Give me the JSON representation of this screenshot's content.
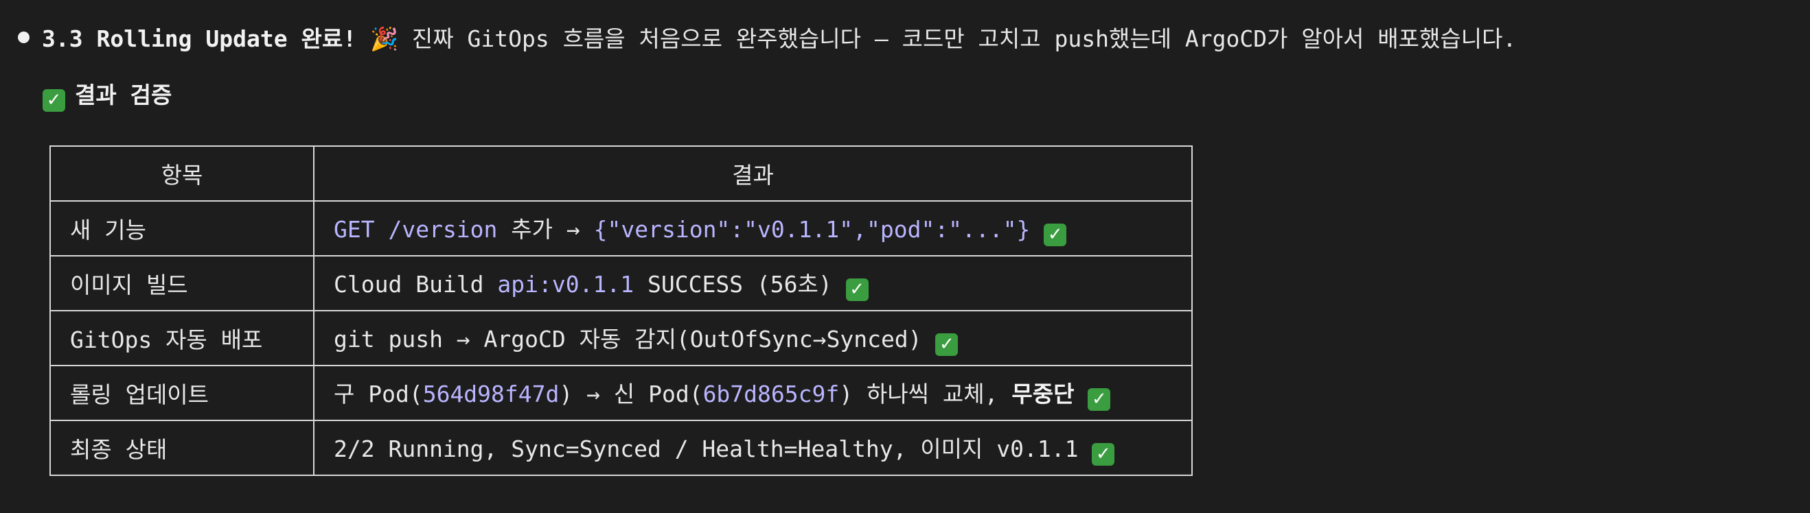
{
  "headline": {
    "title": "3.3 Rolling Update 완료!",
    "party_emoji": "🎉",
    "text": " 진짜 GitOps 흐름을 처음으로 완주했습니다 — 코드만 고치고 push했는데 ArgoCD가 알아서 배포했습니다."
  },
  "section": {
    "check_icon": "✓",
    "title": "결과 검증"
  },
  "table": {
    "headers": [
      "항목",
      "결과"
    ],
    "rows": [
      {
        "item": "새 기능",
        "result_code": "GET /version",
        "result_mid": " 추가 → ",
        "result_code2": "{\"version\":\"v0.1.1\",\"pod\":\"...\"}",
        "result_end": " "
      },
      {
        "item": "이미지 빌드",
        "result_pre": "Cloud Build ",
        "result_code": "api:v0.1.1",
        "result_post": " SUCCESS (56초) "
      },
      {
        "item": "GitOps 자동 배포",
        "result_text": "git push → ArgoCD 자동 감지(OutOfSync→Synced) "
      },
      {
        "item": "롤링 업데이트",
        "result_pre": "구 Pod(",
        "result_code": "564d98f47d",
        "result_mid": ") → 신 Pod(",
        "result_code2": "6b7d865c9f",
        "result_mid2": ") 하나씩 교체, ",
        "result_strong": "무중단",
        "result_end": " "
      },
      {
        "item": "최종 상태",
        "result_text": "2/2 Running, Sync=Synced / Health=Healthy, 이미지 v0.1.1 "
      }
    ]
  },
  "colors": {
    "background": "#1d1d1d",
    "code": "#b9b5ff",
    "check": "#3a9d3f"
  }
}
